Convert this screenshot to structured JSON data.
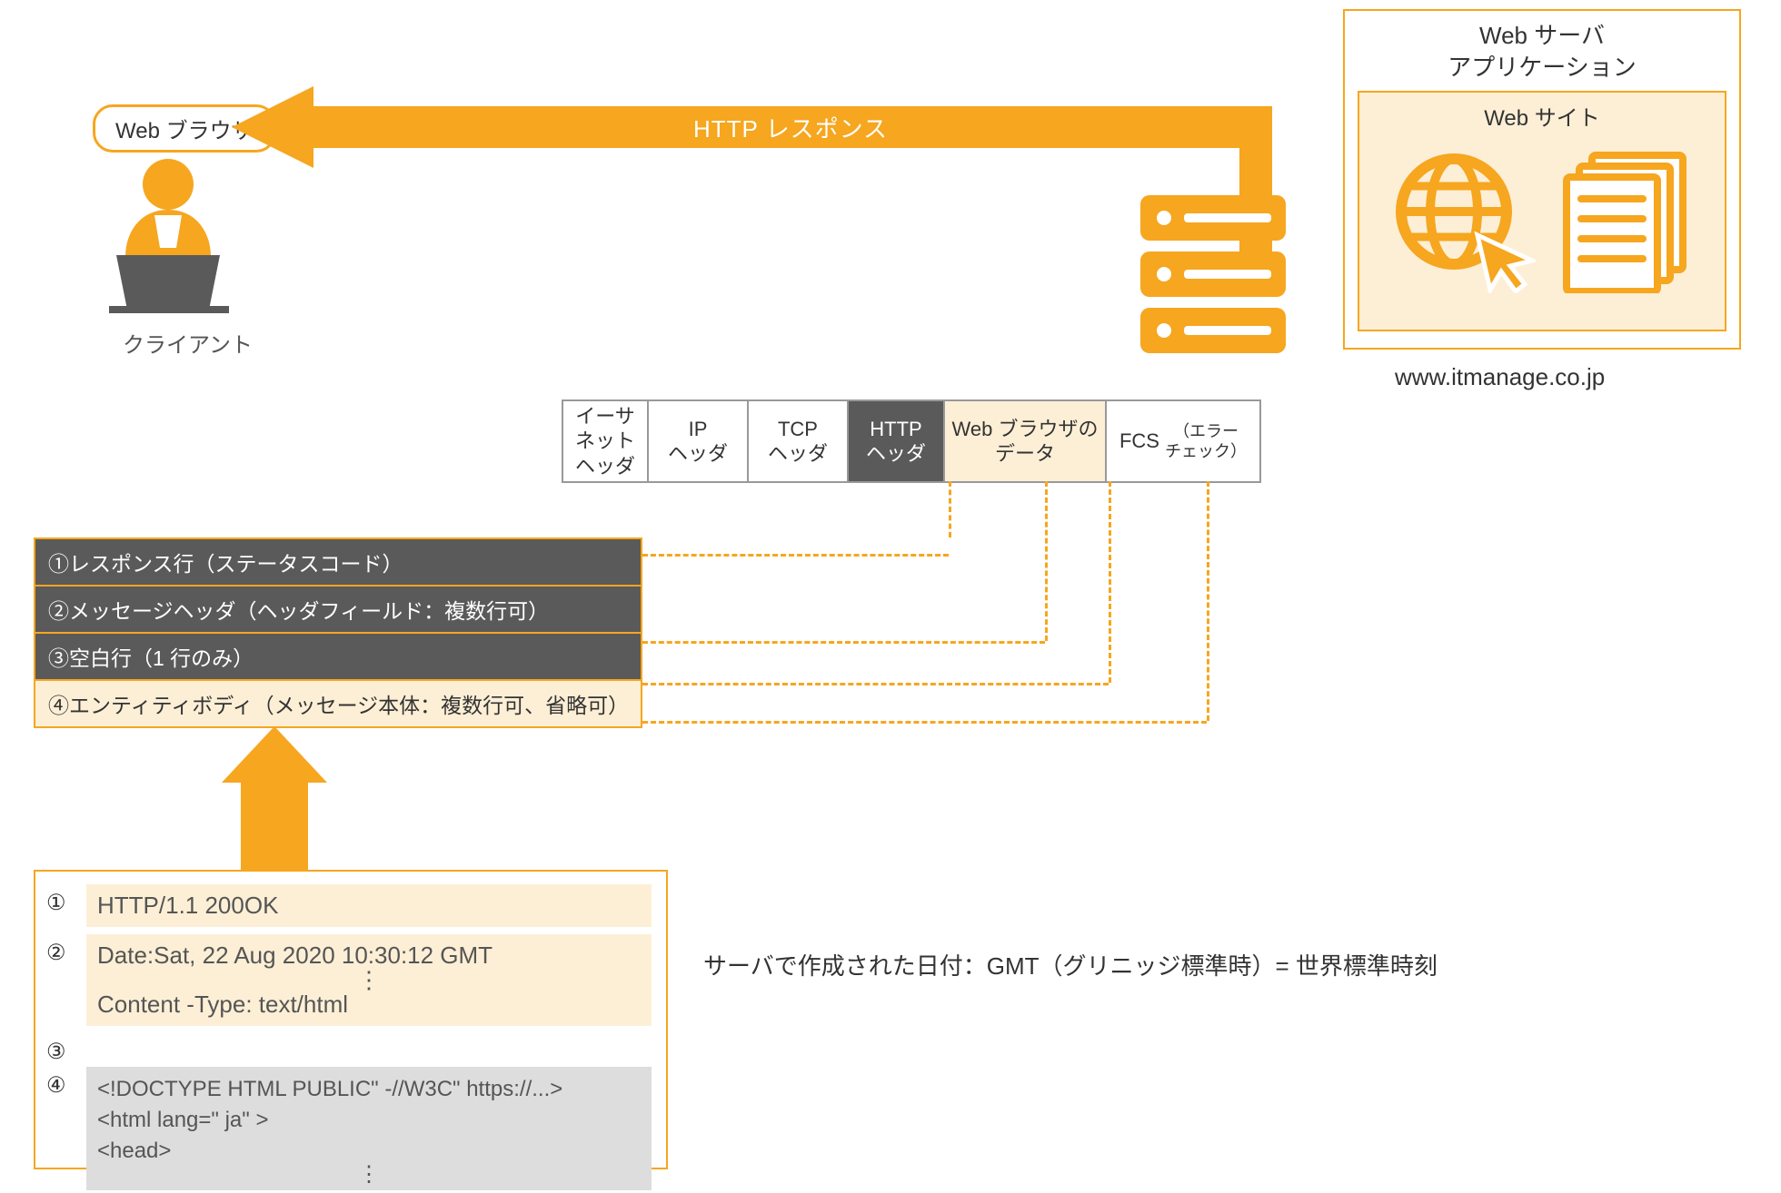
{
  "client": {
    "badge": "Web ブラウザ",
    "label": "クライアント"
  },
  "arrow": {
    "label": "HTTP レスポンス"
  },
  "webserver": {
    "title_line1": "Web サーバ",
    "title_line2": "アプリケーション",
    "site_label": "Web サイト",
    "domain": "www.itmanage.co.jp"
  },
  "packet": {
    "ethernet": "イーサ\nネット\nヘッダ",
    "ip": "IP\nヘッダ",
    "tcp": "TCP\nヘッダ",
    "http": "HTTP\nヘッダ",
    "data": "Web ブラウザの\nデータ",
    "fcs": "FCS",
    "fcs_sub": "（エラー\nチェック）"
  },
  "structure": {
    "r1": "①レスポンス行（ステータスコード）",
    "r2": "②メッセージヘッダ（ヘッダフィールド：複数行可）",
    "r3": "③空白行（1 行のみ）",
    "r4": "④エンティティボディ（メッセージ本体：複数行可、省略可）"
  },
  "example": {
    "n1": "①",
    "n2": "②",
    "n3": "③",
    "n4": "④",
    "line1": "HTTP/1.1 200OK",
    "line2a": "Date:Sat, 22 Aug 2020 10:30:12 GMT",
    "line2b": "Content -Type: text/html",
    "body1": "<!DOCTYPE HTML PUBLIC\" -//W3C\" https://...>",
    "body2": "<html lang=\" ja\" >",
    "body3": "<head>",
    "sidenote": "サーバで作成された日付：GMT（グリニッジ標準時）= 世界標準時刻"
  }
}
